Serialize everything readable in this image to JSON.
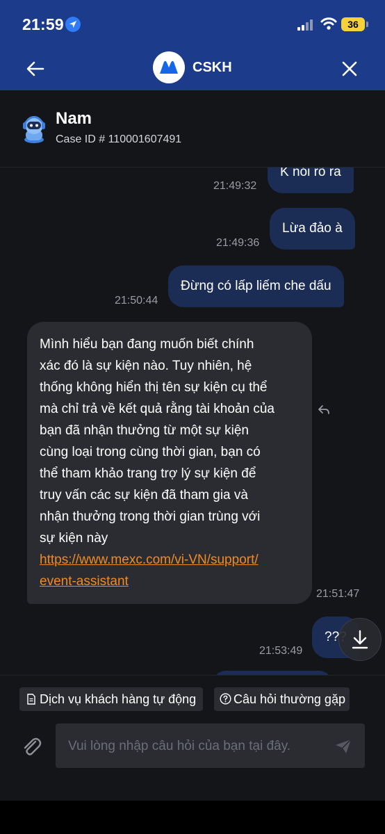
{
  "status": {
    "time": "21:59",
    "battery": "36"
  },
  "header": {
    "title": "CSKH"
  },
  "agent": {
    "name": "Nam",
    "case_id": "Case ID # 110001607491"
  },
  "messages": [
    {
      "from": "user",
      "text": "K nói rõ ra",
      "time": "21:49:32"
    },
    {
      "from": "user",
      "text": "Lừa đảo à",
      "time": "21:49:36"
    },
    {
      "from": "user",
      "text": "Đừng có lấp liếm che dấu",
      "time": "21:50:44"
    },
    {
      "from": "agent",
      "lines": [
        "Mình hiểu bạn đang muốn biết chính",
        "xác đó là sự kiện nào. Tuy nhiên, hệ",
        "thống không hiển thị tên sự kiện cụ thể",
        "mà chỉ trả về kết quả rằng tài khoản của",
        "bạn đã nhận thưởng từ một sự kiện",
        "cùng loại trong cùng thời gian, bạn có",
        "thể tham khảo trang trợ lý sự kiện để",
        "truy vấn các sự kiện đã tham gia và",
        "nhận thưởng trong thời gian trùng với",
        "sự kiện này"
      ],
      "link_lines": [
        "https://www.mexc.com/vi-VN/support/",
        "event-assistant"
      ],
      "time": "21:51:47"
    },
    {
      "from": "user",
      "text": "???",
      "time": "21:53:49"
    }
  ],
  "quick_actions": {
    "auto_service": "Dịch vụ khách hàng tự động",
    "faq": "Câu hỏi thường gặp"
  },
  "composer": {
    "placeholder": "Vui lòng nhập câu hỏi của bạn tại đây."
  },
  "colors": {
    "header_bg": "#1c3b8a",
    "outgoing_bubble": "#1b2d55",
    "incoming_bubble": "#2b2c32",
    "link": "#f08a24"
  }
}
